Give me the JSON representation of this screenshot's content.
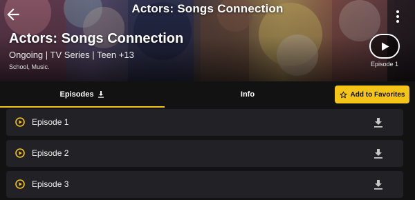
{
  "header": {
    "top_title": "Actors: Songs Connection"
  },
  "show": {
    "title": "Actors: Songs Connection",
    "meta": "Ongoing | TV Series | Teen +13",
    "genres": "School, Music.",
    "play_caption": "Episode 1"
  },
  "tabs": {
    "episodes": "Episodes",
    "info": "Info",
    "active": "Episodes"
  },
  "favorites_label": "Add to Favorites",
  "episodes": [
    {
      "label": "Episode 1"
    },
    {
      "label": "Episode 2"
    },
    {
      "label": "Episode 3"
    }
  ],
  "colors": {
    "accent": "#f5c418",
    "background": "#121212",
    "row_background": "#222226"
  },
  "icons": {
    "back": "arrow-left",
    "more": "three-dots-vertical",
    "play": "play-triangle",
    "episode_play": "circle-play",
    "download": "download-arrow",
    "star": "star-outline"
  }
}
